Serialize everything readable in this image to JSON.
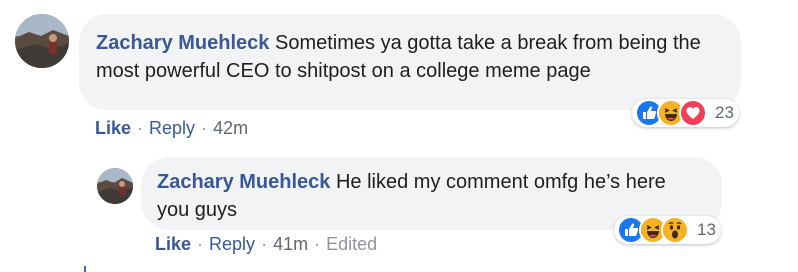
{
  "comments": [
    {
      "author": "Zachary Muehleck",
      "text": "Sometimes ya gotta take a break from being the most powerful CEO to shitpost on a college meme page",
      "actions": {
        "like": "Like",
        "reply": "Reply",
        "time": "42m"
      },
      "reactions": {
        "icons": [
          "like-icon",
          "haha-icon",
          "love-icon"
        ],
        "count": "23"
      }
    },
    {
      "author": "Zachary Muehleck",
      "text": "He liked my comment omfg he’s here you guys",
      "actions": {
        "like": "Like",
        "reply": "Reply",
        "time": "41m",
        "edited": "Edited"
      },
      "reactions": {
        "icons": [
          "like-icon",
          "haha-icon",
          "wow-icon"
        ],
        "count": "13"
      }
    }
  ],
  "separator": "·",
  "colors": {
    "link": "#385898",
    "bubble": "#f2f3f5",
    "muted": "#90949c",
    "like": "#1877f2",
    "love": "#f33e58",
    "haha": "#f7b125"
  }
}
